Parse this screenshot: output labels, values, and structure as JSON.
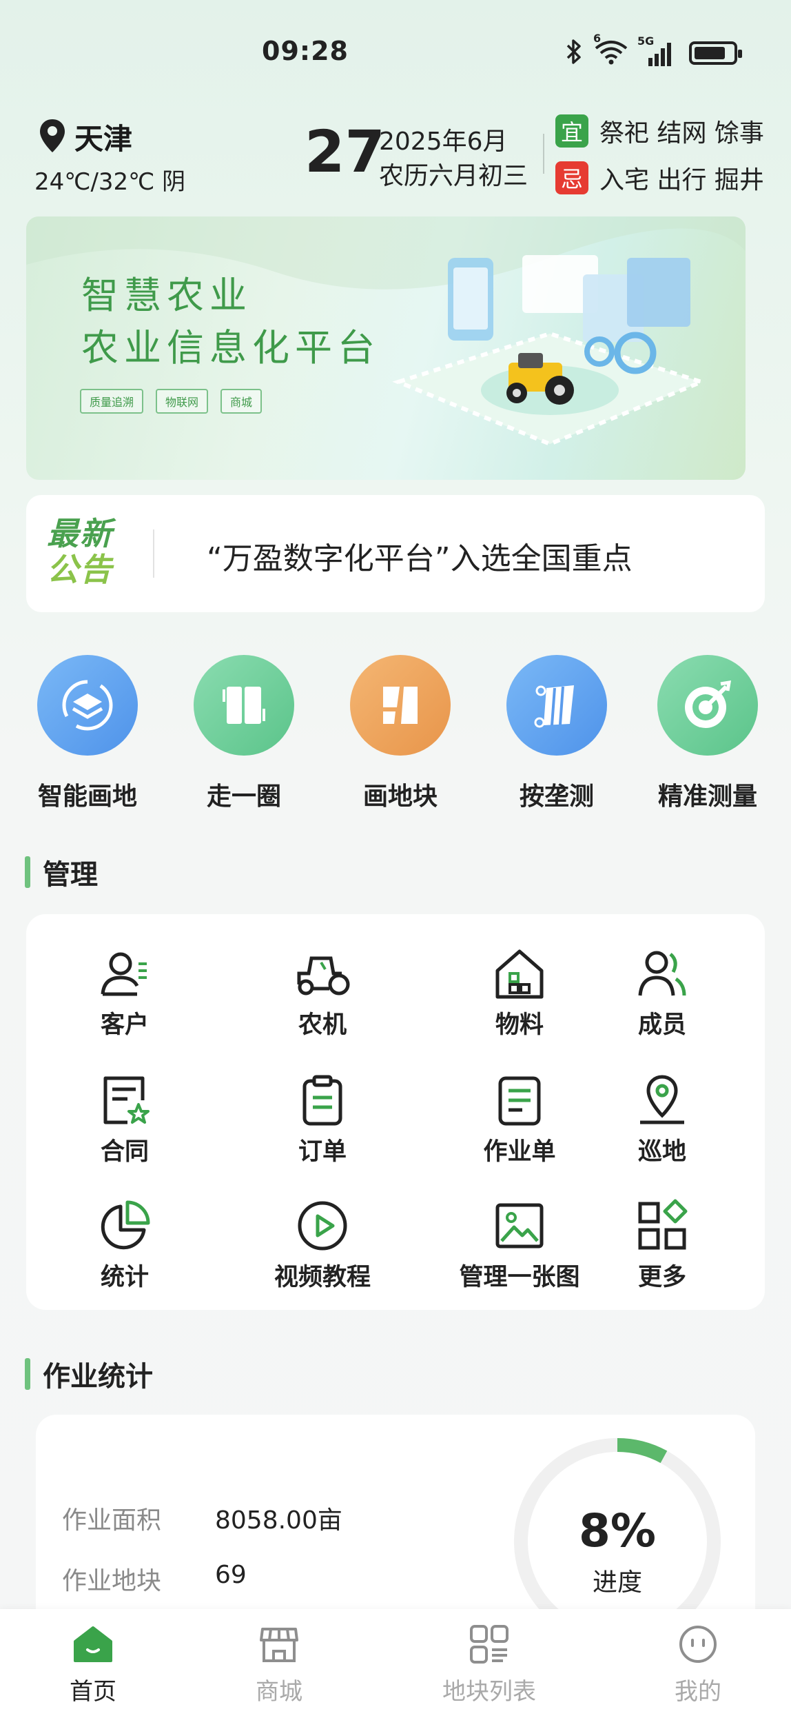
{
  "status_bar": {
    "time": "09:28",
    "icons": [
      "bluetooth-icon",
      "wifi-icon",
      "signal-5g-icon",
      "battery-icon"
    ],
    "wifi_badge": "6",
    "signal_badge": "5G"
  },
  "weather": {
    "city": "天津",
    "summary": "24℃/32℃ 阴"
  },
  "calendar": {
    "day": "27",
    "year_month": "2025年6月",
    "lunar": "农历六月初三",
    "yi_tag": "宜",
    "yi_items": "祭祀 结网 馀事",
    "ji_tag": "忌",
    "ji_items": "入宅 出行 掘井"
  },
  "banner": {
    "title_line1": "智慧农业",
    "title_line2": "农业信息化平台",
    "tags": [
      "质量追溯",
      "物联网",
      "商城"
    ]
  },
  "notice": {
    "badge_line1": "最新",
    "badge_line2": "公告",
    "text": "“万盈数字化平台”入选全国重点"
  },
  "quick_tools": [
    {
      "label": "智能画地",
      "icon": "layers-icon",
      "color": "#5ea4f2"
    },
    {
      "label": "走一圈",
      "icon": "walk-boundary-icon",
      "color": "#6ccf98"
    },
    {
      "label": "画地块",
      "icon": "draw-plot-icon",
      "color": "#eea35a"
    },
    {
      "label": "按垄测",
      "icon": "ridge-measure-icon",
      "color": "#5ea4f2"
    },
    {
      "label": "精准测量",
      "icon": "target-icon",
      "color": "#6ccf98"
    }
  ],
  "management": {
    "title": "管理",
    "items": [
      {
        "label": "客户",
        "icon": "customer-icon"
      },
      {
        "label": "农机",
        "icon": "tractor-icon"
      },
      {
        "label": "物料",
        "icon": "warehouse-icon"
      },
      {
        "label": "成员",
        "icon": "members-icon"
      },
      {
        "label": "合同",
        "icon": "contract-icon"
      },
      {
        "label": "订单",
        "icon": "order-icon"
      },
      {
        "label": "作业单",
        "icon": "work-order-icon"
      },
      {
        "label": "巡地",
        "icon": "patrol-location-icon"
      },
      {
        "label": "统计",
        "icon": "pie-chart-icon"
      },
      {
        "label": "视频教程",
        "icon": "play-video-icon"
      },
      {
        "label": "管理一张图",
        "icon": "image-map-icon"
      },
      {
        "label": "更多",
        "icon": "more-apps-icon"
      }
    ]
  },
  "work_stats": {
    "title": "作业统计",
    "area_label": "作业面积",
    "area_value": "8058.00亩",
    "plots_label": "作业地块",
    "plots_value": "69",
    "progress_percent": 8,
    "progress_text": "8%",
    "progress_label": "进度"
  },
  "tabbar": {
    "tabs": [
      {
        "label": "首页",
        "icon": "home-icon",
        "active": true
      },
      {
        "label": "商城",
        "icon": "store-icon",
        "active": false
      },
      {
        "label": "地块列表",
        "icon": "plot-list-icon",
        "active": false
      },
      {
        "label": "我的",
        "icon": "profile-icon",
        "active": false
      }
    ]
  },
  "colors": {
    "accent_green": "#3aa34a",
    "ji_red": "#e63b32",
    "progress_green": "#5cb86b",
    "ring_track": "#f0f0f0"
  }
}
